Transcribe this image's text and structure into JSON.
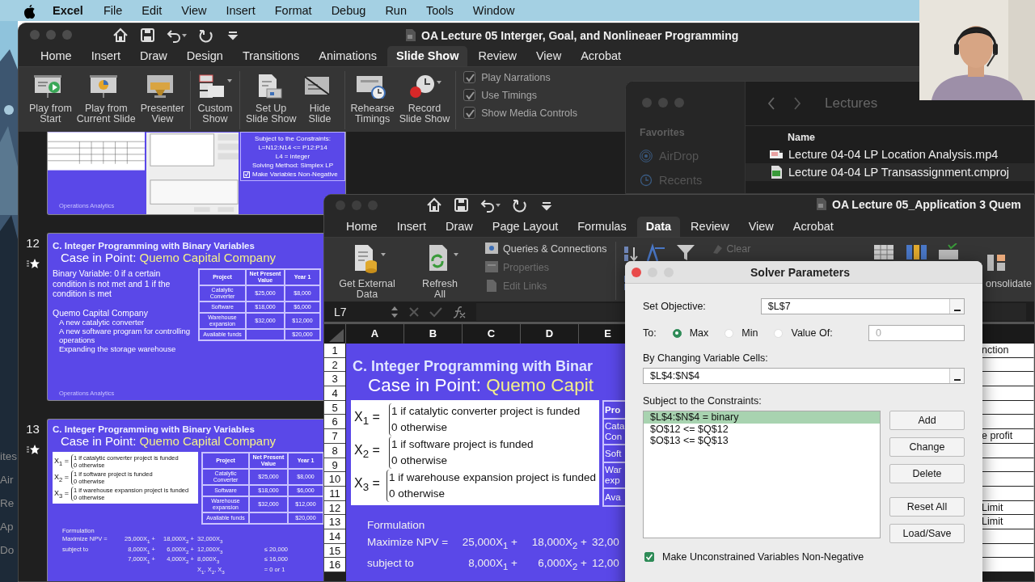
{
  "menu_bar": {
    "app": "Excel",
    "items": [
      "File",
      "Edit",
      "View",
      "Insert",
      "Format",
      "Debug",
      "Run",
      "Tools",
      "Window"
    ]
  },
  "background_sidebar": [
    "ites",
    "Air",
    "Re",
    "Ap",
    "Do"
  ],
  "powerpoint": {
    "title": "OA Lecture 05 Interger, Goal, and Nonlineaer Programming",
    "tabs": [
      {
        "label": "Home",
        "selected": false
      },
      {
        "label": "Insert",
        "selected": false
      },
      {
        "label": "Draw",
        "selected": false
      },
      {
        "label": "Design",
        "selected": false
      },
      {
        "label": "Transitions",
        "selected": false
      },
      {
        "label": "Animations",
        "selected": false
      },
      {
        "label": "Slide Show",
        "selected": true
      },
      {
        "label": "Review",
        "selected": false
      },
      {
        "label": "View",
        "selected": false
      },
      {
        "label": "Acrobat",
        "selected": false
      }
    ],
    "ribbon_groups": [
      [
        {
          "label": "Play from\nStart",
          "kind": "play-start"
        },
        {
          "label": "Play from\nCurrent Slide",
          "kind": "play-current"
        },
        {
          "label": "Presenter\nView",
          "kind": "presenter"
        }
      ],
      [
        {
          "label": "Custom\nShow",
          "kind": "custom"
        }
      ],
      [
        {
          "label": "Set Up\nSlide Show",
          "kind": "setup"
        },
        {
          "label": "Hide\nSlide",
          "kind": "hide"
        }
      ],
      [
        {
          "label": "Rehearse\nTimings",
          "kind": "rehearse"
        },
        {
          "label": "Record\nSlide Show",
          "kind": "record"
        }
      ]
    ],
    "options": [
      {
        "label": "Play Narrations",
        "checked": true
      },
      {
        "label": "Use Timings",
        "checked": true
      },
      {
        "label": "Show Media Controls",
        "checked": true
      }
    ],
    "slides": [
      {
        "kind": "solver-notes",
        "lines": [
          "Subject to the Constraints:",
          "L=N12:N14 <= P12:P14",
          "L4 = integer",
          "Solving Method: Simplex LP"
        ],
        "check": {
          "label": "Make Variables Non-Negative",
          "checked": true
        },
        "footer": "Operations Analytics"
      },
      {
        "kind": "bullets",
        "number": "12",
        "starred": true,
        "title": "C. Integer Programming with Binary Variables",
        "subtitle": "Case in Point: ",
        "subtitle_highlight": "Quemo Capital Company",
        "intro": "Binary Variable: 0 if a certain condition is not met and 1 if the condition is met",
        "company": "Quemo Capital Company",
        "items": [
          "A new catalytic converter",
          "A new software program for controlling operations",
          "Expanding the storage warehouse"
        ],
        "table": {
          "columns": [
            "Project",
            "Net Present Value",
            "Year 1"
          ],
          "rows": [
            {
              "project": "Catalytic Converter",
              "npv": "$25,000",
              "year_1": "$8,000"
            },
            {
              "project": "Software",
              "npv": "$18,000",
              "year_1": "$6,000"
            },
            {
              "project": "Warehouse expansion",
              "npv": "$32,000",
              "year_1": "$12,000"
            },
            {
              "project": "Available funds",
              "year_1": "$20,000"
            }
          ]
        },
        "footer": "Operations Analytics"
      },
      {
        "kind": "formulation",
        "number": "13",
        "starred": true,
        "title": "C. Integer Programming with Binary Variables",
        "subtitle": "Case in Point: ",
        "subtitle_highlight": "Quemo Capital Company",
        "definitions": [
          {
            "variable": "X$_{1}$ =",
            "cases": [
              "1 if catalytic converter project is funded",
              "0 otherwise"
            ]
          },
          {
            "variable": "X$_{2}$ =",
            "cases": [
              "1 if software project is funded",
              "0 otherwise"
            ]
          },
          {
            "variable": "X$_{3}$ =",
            "cases": [
              "1 if warehouse expansion project is funded",
              "0 otherwise"
            ]
          }
        ],
        "table": {
          "columns": [
            "Project",
            "Net Present Value",
            "Year 1"
          ],
          "rows": [
            {
              "project": "Catalytic Converter",
              "npv": "$25,000",
              "year_1": "$8,000"
            },
            {
              "project": "Software",
              "npv": "$18,000",
              "year_1": "$6,000"
            },
            {
              "project": "Warehouse expansion",
              "npv": "$32,000",
              "year_1": "$12,000"
            },
            {
              "project": "Available funds",
              "year_1": "$20,000"
            }
          ]
        },
        "formulation_heading": "Formulation",
        "formulation": [
          {
            "label": "Maximize NPV =",
            "terms": [
              "25,000X$_{1}$ +",
              "18,000X$_{2}$ +",
              "32,000X$_{3}$"
            ]
          },
          {
            "label": "subject to",
            "terms": [
              "8,000X$_{1}$ +",
              "6,000X$_{2}$ +",
              "12,000X$_{3}$"
            ],
            "bound": "≤ 20,000"
          },
          {
            "terms": [
              "7,000X$_{1}$ +",
              "4,000X$_{2}$ +",
              "8,000X$_{3}$"
            ],
            "bound": "≤ 16,000"
          },
          {
            "terms": [
              "X$_{1}$, X$_{2}$, X$_{3}$"
            ],
            "bound": "= 0 or 1"
          }
        ]
      }
    ]
  },
  "finder": {
    "favorites_label": "Favorites",
    "sidebar": [
      {
        "label": "AirDrop",
        "kind": "airdrop"
      },
      {
        "label": "Recents",
        "kind": "recents"
      }
    ],
    "folder": "Lectures",
    "column": "Name",
    "files": [
      {
        "name": "Lecture 04-04 LP Location Analysis.mp4",
        "kind": "video",
        "selected": false
      },
      {
        "name": "Lecture 04-04 LP Transassignment.cmproj",
        "kind": "project",
        "selected": true
      }
    ]
  },
  "excel": {
    "title": "OA Lecture 05_Application 3 Quem",
    "tabs": [
      {
        "label": "Home",
        "selected": false
      },
      {
        "label": "Insert",
        "selected": false
      },
      {
        "label": "Draw",
        "selected": false
      },
      {
        "label": "Page Layout",
        "selected": false
      },
      {
        "label": "Formulas",
        "selected": false
      },
      {
        "label": "Data",
        "selected": true
      },
      {
        "label": "Review",
        "selected": false
      },
      {
        "label": "View",
        "selected": false
      },
      {
        "label": "Acrobat",
        "selected": false
      }
    ],
    "get_external": "Get External\nData",
    "refresh": "Refresh\nAll",
    "links": [
      {
        "label": "Queries & Connections",
        "disabled": false
      },
      {
        "label": "Properties",
        "disabled": true
      },
      {
        "label": "Edit Links",
        "disabled": true
      }
    ],
    "clear": {
      "label": "Clear",
      "disabled": true
    },
    "consolidate": "onsolidate",
    "name_box": "L7",
    "columns": [
      "A",
      "B",
      "C",
      "D",
      "E"
    ],
    "rows": [
      "1",
      "2",
      "3",
      "4",
      "5",
      "6",
      "7",
      "8",
      "9",
      "10",
      "11",
      "12",
      "13",
      "14",
      "15",
      "16"
    ],
    "right_cells": [
      {
        "text": "nction"
      },
      {},
      {},
      {},
      {},
      {},
      {
        "text": "e profit"
      },
      {},
      {},
      {},
      {},
      {
        "text": "Limit"
      },
      {
        "text": "Limit"
      },
      {},
      {},
      {}
    ],
    "pasted_slide": {
      "title": "C. Integer Programming with Binar",
      "subtitle": "Case in Point: ",
      "subtitle_highlight": "Quemo Capit",
      "definitions": [
        {
          "variable": "X$_{1}$ =",
          "cases": [
            "1 if catalytic converter project is funded",
            "0 otherwise"
          ]
        },
        {
          "variable": "X$_{2}$ =",
          "cases": [
            "1 if software project is funded",
            "0 otherwise"
          ]
        },
        {
          "variable": "X$_{3}$ =",
          "cases": [
            "1 if warehouse expansion project is funded",
            "0 otherwise"
          ]
        }
      ],
      "table_cells": [
        "Pro",
        "Cata\nCon",
        "Soft",
        "War\nexp",
        "Ava"
      ],
      "formulation_heading": "Formulation",
      "formulation": [
        {
          "label": "Maximize NPV =",
          "terms": [
            "25,000X$_{1}$ +",
            "18,000X$_{2}$ +",
            "32,00"
          ]
        },
        {
          "label": "subject to",
          "terms": [
            "8,000X$_{1}$ +",
            "6,000X$_{2}$ +",
            "12,00"
          ]
        }
      ]
    }
  },
  "solver": {
    "title": "Solver Parameters",
    "objective_label": "Set Objective:",
    "objective": "$L$7",
    "to_label": "To:",
    "targets": [
      {
        "label": "Max",
        "selected": true
      },
      {
        "label": "Min",
        "selected": false
      },
      {
        "label": "Value Of:",
        "selected": false
      }
    ],
    "value_of": "0",
    "cells_label": "By Changing Variable Cells:",
    "cells": "$L$4:$N$4",
    "constraints_label": "Subject to the Constraints:",
    "constraints": [
      {
        "text": "$L$4:$N$4 = binary",
        "selected": true
      },
      {
        "text": "$O$12 <= $Q$12",
        "selected": false
      },
      {
        "text": "$O$13 <= $Q$13",
        "selected": false
      }
    ],
    "buttons": [
      "Add",
      "Change",
      "Delete",
      "Reset All",
      "Load/Save"
    ],
    "nonnegative": {
      "label": "Make Unconstrained Variables Non-Negative",
      "checked": true
    }
  }
}
